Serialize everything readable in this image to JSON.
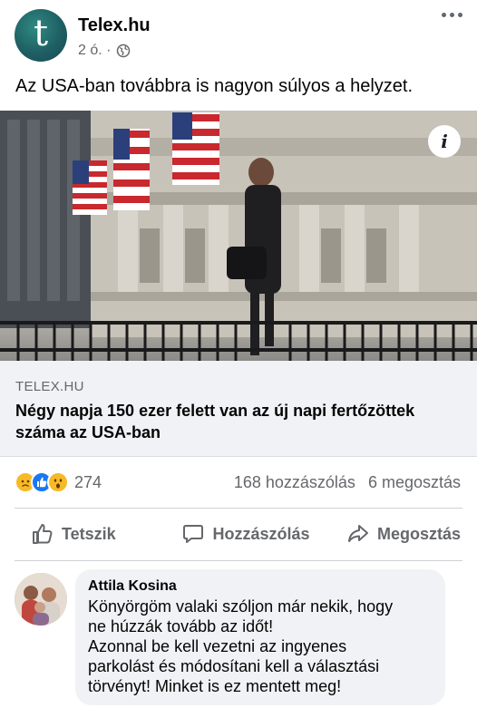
{
  "post": {
    "page_name": "Telex.hu",
    "avatar_letter": "t",
    "time": "2 ó. ·",
    "text": "Az USA-ban továbbra is nagyon súlyos a helyzet."
  },
  "link": {
    "domain": "TELEX.HU",
    "headline_line1": "Négy napja 150 ezer felett van az új napi fertőzöttek",
    "headline_line2": "száma az USA-ban"
  },
  "stats": {
    "reaction_count": "274",
    "comments": "168 hozzászólás",
    "shares": "6 megosztás"
  },
  "actions": {
    "like": "Tetszik",
    "comment": "Hozzászólás",
    "share": "Megosztás"
  },
  "comment": {
    "author": "Attila Kosina",
    "line1": "Könyörgöm valaki szóljon már nekik, hogy",
    "line2": "ne húzzák tovább az időt!",
    "line3": "Azonnal be kell vezetni az ingyenes",
    "line4": "parkolást és módosítani kell a választási",
    "line5": "törvényt! Minket is ez mentett meg!"
  },
  "colors": {
    "secondary_text": "#65676b",
    "card_bg": "#f0f2f5",
    "like_blue": "#1877f2",
    "haha_yellow": "#f7b928",
    "avatar_teal": "#1f5f63"
  }
}
